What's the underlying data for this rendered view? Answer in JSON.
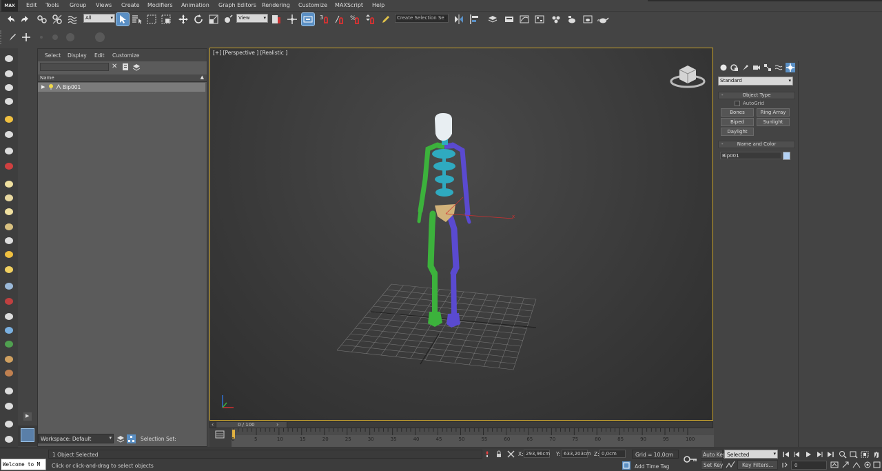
{
  "menu": {
    "logo": "MAX",
    "items": [
      "Edit",
      "Tools",
      "Group",
      "Views",
      "Create",
      "Modifiers",
      "Animation",
      "Graph Editors",
      "Rendering",
      "Customize",
      "MAXScript",
      "Help"
    ]
  },
  "toolbar": {
    "filter_dropdown": "All",
    "ref_coord_dropdown": "View",
    "selection_set_dropdown": "Create Selection Se",
    "snap_label": "3"
  },
  "explorer": {
    "menu": [
      "Select",
      "Display",
      "Edit",
      "Customize"
    ],
    "column_name": "Name",
    "rows": [
      {
        "name": "Bip001"
      }
    ]
  },
  "viewport": {
    "label": "[+] [Perspective ] [Realistic ]"
  },
  "timeline": {
    "slider_text": "0 / 100",
    "ticks": [
      "0",
      "5",
      "10",
      "15",
      "20",
      "25",
      "30",
      "35",
      "40",
      "45",
      "50",
      "55",
      "60",
      "65",
      "70",
      "75",
      "80",
      "85",
      "90",
      "95",
      "100"
    ]
  },
  "command_panel": {
    "category_dropdown": "Standard",
    "object_type_title": "Object Type",
    "autogrid_label": "AutoGrid",
    "buttons": [
      "Bones",
      "Ring Array",
      "Biped",
      "Sunlight",
      "Daylight"
    ],
    "name_color_title": "Name and Color",
    "name_value": "Bip001",
    "swatch_color": "#b4d2f5"
  },
  "bottom": {
    "workspace": "Workspace: Default",
    "selection_set_label": "Selection Set:",
    "maxscript_listener": "Welcome to M",
    "status_line": "1 Object Selected",
    "prompt_line": "Click or click-and-drag to select objects",
    "x_label": "X:",
    "x_value": "293,96cm",
    "y_label": "Y:",
    "y_value": "633,203cm",
    "z_label": "Z:",
    "z_value": "0,0cm",
    "grid": "Grid = 10,0cm",
    "add_time_tag": "Add Time Tag",
    "auto_key": "Auto Key",
    "set_key": "Set Key",
    "key_mode_dropdown": "Selected",
    "key_filters": "Key Filters...",
    "frame_value": "0"
  },
  "colors": {
    "left_side": "#3cb23c",
    "right_side": "#5a4ad0",
    "spine": "#2faac0",
    "pelvis": "#d2b27a",
    "viewport_border": "#c8a22a",
    "accent": "#5a8fc4"
  }
}
